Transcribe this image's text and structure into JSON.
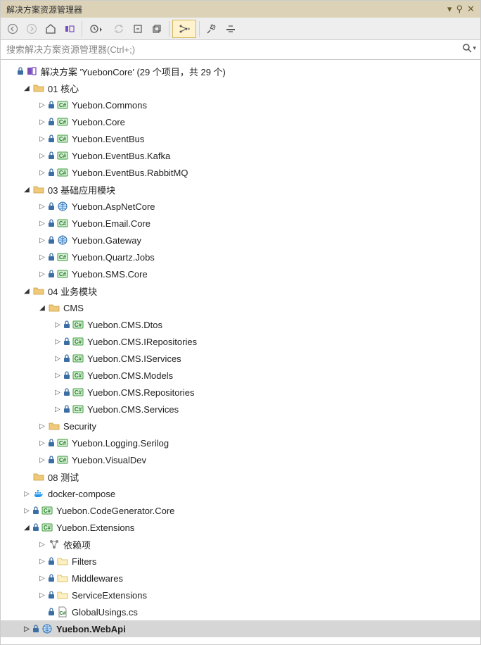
{
  "title": "解决方案资源管理器",
  "search": {
    "placeholder": "搜索解决方案资源管理器(Ctrl+;)"
  },
  "tree": [
    {
      "depth": 0,
      "chev": "null",
      "lock": true,
      "icon": "solution",
      "label": "解决方案 'YuebonCore' (29 个项目，共 29 个)",
      "interact": true
    },
    {
      "depth": 1,
      "chev": "open",
      "lock": false,
      "icon": "folder",
      "label": "01 核心",
      "interact": true
    },
    {
      "depth": 2,
      "chev": "closed",
      "lock": true,
      "icon": "csproj",
      "label": "Yuebon.Commons",
      "interact": true
    },
    {
      "depth": 2,
      "chev": "closed",
      "lock": true,
      "icon": "csproj",
      "label": "Yuebon.Core",
      "interact": true
    },
    {
      "depth": 2,
      "chev": "closed",
      "lock": true,
      "icon": "csproj",
      "label": "Yuebon.EventBus",
      "interact": true
    },
    {
      "depth": 2,
      "chev": "closed",
      "lock": true,
      "icon": "csproj",
      "label": "Yuebon.EventBus.Kafka",
      "interact": true
    },
    {
      "depth": 2,
      "chev": "closed",
      "lock": true,
      "icon": "csproj",
      "label": "Yuebon.EventBus.RabbitMQ",
      "interact": true
    },
    {
      "depth": 1,
      "chev": "open",
      "lock": false,
      "icon": "folder",
      "label": "03 基础应用模块",
      "interact": true
    },
    {
      "depth": 2,
      "chev": "closed",
      "lock": true,
      "icon": "webproj",
      "label": "Yuebon.AspNetCore",
      "interact": true
    },
    {
      "depth": 2,
      "chev": "closed",
      "lock": true,
      "icon": "csproj",
      "label": "Yuebon.Email.Core",
      "interact": true
    },
    {
      "depth": 2,
      "chev": "closed",
      "lock": true,
      "icon": "webproj",
      "label": "Yuebon.Gateway",
      "interact": true
    },
    {
      "depth": 2,
      "chev": "closed",
      "lock": true,
      "icon": "csproj",
      "label": "Yuebon.Quartz.Jobs",
      "interact": true
    },
    {
      "depth": 2,
      "chev": "closed",
      "lock": true,
      "icon": "csproj",
      "label": "Yuebon.SMS.Core",
      "interact": true
    },
    {
      "depth": 1,
      "chev": "open",
      "lock": false,
      "icon": "folder",
      "label": "04 业务模块",
      "interact": true
    },
    {
      "depth": 2,
      "chev": "open",
      "lock": false,
      "icon": "folder",
      "label": "CMS",
      "interact": true
    },
    {
      "depth": 3,
      "chev": "closed",
      "lock": true,
      "icon": "csproj",
      "label": "Yuebon.CMS.Dtos",
      "interact": true
    },
    {
      "depth": 3,
      "chev": "closed",
      "lock": true,
      "icon": "csproj",
      "label": "Yuebon.CMS.IRepositories",
      "interact": true
    },
    {
      "depth": 3,
      "chev": "closed",
      "lock": true,
      "icon": "csproj",
      "label": "Yuebon.CMS.IServices",
      "interact": true
    },
    {
      "depth": 3,
      "chev": "closed",
      "lock": true,
      "icon": "csproj",
      "label": "Yuebon.CMS.Models",
      "interact": true
    },
    {
      "depth": 3,
      "chev": "closed",
      "lock": true,
      "icon": "csproj",
      "label": "Yuebon.CMS.Repositories",
      "interact": true
    },
    {
      "depth": 3,
      "chev": "closed",
      "lock": true,
      "icon": "csproj",
      "label": "Yuebon.CMS.Services",
      "interact": true
    },
    {
      "depth": 2,
      "chev": "closed",
      "lock": false,
      "icon": "folder",
      "label": "Security",
      "interact": true
    },
    {
      "depth": 2,
      "chev": "closed",
      "lock": true,
      "icon": "csproj",
      "label": "Yuebon.Logging.Serilog",
      "interact": true
    },
    {
      "depth": 2,
      "chev": "closed",
      "lock": true,
      "icon": "csproj",
      "label": "Yuebon.VisualDev",
      "interact": true
    },
    {
      "depth": 1,
      "chev": "null",
      "lock": false,
      "icon": "folder",
      "label": "08 测试",
      "interact": true
    },
    {
      "depth": 1,
      "chev": "closed",
      "lock": false,
      "icon": "docker",
      "label": "docker-compose",
      "interact": true
    },
    {
      "depth": 1,
      "chev": "closed",
      "lock": true,
      "icon": "csproj",
      "label": "Yuebon.CodeGenerator.Core",
      "interact": true
    },
    {
      "depth": 1,
      "chev": "open",
      "lock": true,
      "icon": "csproj",
      "label": "Yuebon.Extensions",
      "interact": true
    },
    {
      "depth": 2,
      "chev": "closed",
      "lock": false,
      "icon": "deps",
      "label": "依赖项",
      "interact": true
    },
    {
      "depth": 2,
      "chev": "closed",
      "lock": true,
      "icon": "folderY",
      "label": "Filters",
      "interact": true
    },
    {
      "depth": 2,
      "chev": "closed",
      "lock": true,
      "icon": "folderY",
      "label": "Middlewares",
      "interact": true
    },
    {
      "depth": 2,
      "chev": "closed",
      "lock": true,
      "icon": "folderY",
      "label": "ServiceExtensions",
      "interact": true
    },
    {
      "depth": 2,
      "chev": "null",
      "lock": true,
      "icon": "csfile",
      "label": "GlobalUsings.cs",
      "interact": true
    },
    {
      "depth": 1,
      "chev": "closed",
      "lock": true,
      "icon": "webproj",
      "label": "Yuebon.WebApi",
      "interact": true,
      "selected": true,
      "bold": true
    }
  ]
}
